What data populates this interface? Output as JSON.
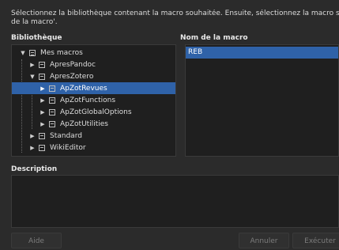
{
  "instructions": {
    "line1": "Sélectionnez la bibliothèque contenant la macro souhaitée. Ensuite, sélectionnez la macro sous 'Nom",
    "line2": "de la macro'."
  },
  "library": {
    "label": "Bibliothèque",
    "tree": [
      {
        "label": "Mes macros",
        "expanded": true,
        "selected": false
      },
      {
        "label": "ApresPandoc",
        "expanded": false,
        "selected": false
      },
      {
        "label": "ApresZotero",
        "expanded": true,
        "selected": false
      },
      {
        "label": "ApZotRevues",
        "expanded": false,
        "selected": true
      },
      {
        "label": "ApZotFunctions",
        "expanded": false,
        "selected": false
      },
      {
        "label": "ApZotGlobalOptions",
        "expanded": false,
        "selected": false
      },
      {
        "label": "ApZotUtilities",
        "expanded": false,
        "selected": false
      },
      {
        "label": "Standard",
        "expanded": false,
        "selected": false
      },
      {
        "label": "WikiEditor",
        "expanded": false,
        "selected": false
      }
    ]
  },
  "macro_name": {
    "label": "Nom de la macro",
    "items": [
      "REB"
    ]
  },
  "description": {
    "label": "Description",
    "text": ""
  },
  "buttons": {
    "help": "Aide",
    "cancel": "Annuler",
    "run": "Exécuter"
  },
  "colors": {
    "selection": "#2f62a8",
    "background": "#2b2b2b",
    "panel": "#1f1f1f"
  }
}
